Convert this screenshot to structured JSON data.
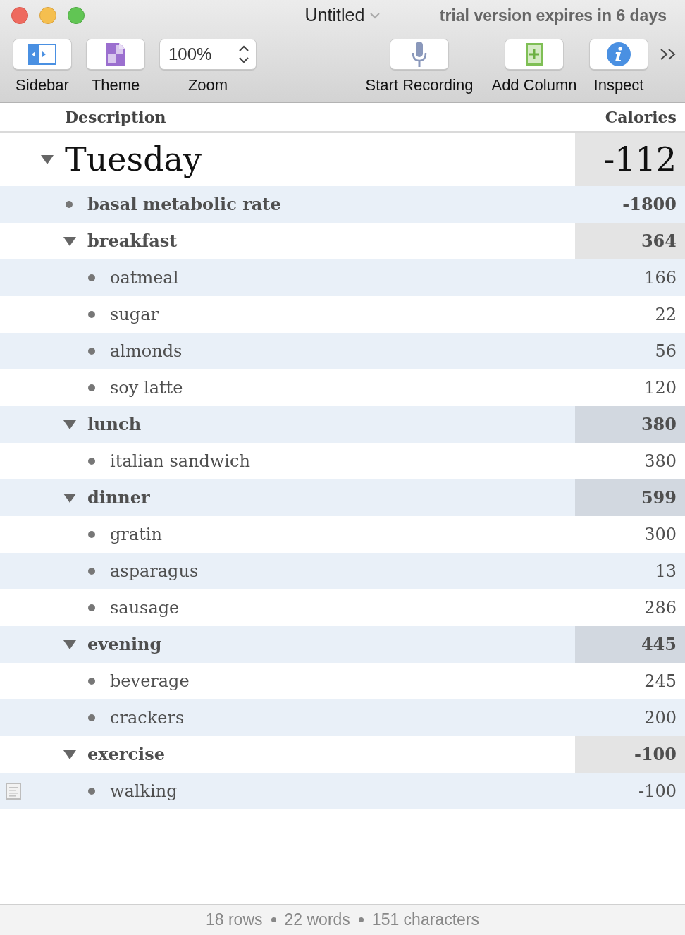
{
  "window": {
    "title": "Untitled",
    "notice": "trial version expires in 6 days"
  },
  "toolbar": {
    "left": [
      {
        "kind": "button",
        "label": "Sidebar"
      },
      {
        "kind": "button",
        "label": "Theme"
      },
      {
        "kind": "stepper",
        "label": "Zoom",
        "value": "100%"
      }
    ],
    "right": [
      {
        "kind": "button",
        "label": "Start Recording"
      },
      {
        "kind": "button",
        "label": "Add Column"
      },
      {
        "kind": "button",
        "label": "Inspect"
      }
    ]
  },
  "table": {
    "columns": [
      "Description",
      "Calories"
    ],
    "rows": [
      {
        "description": "Tuesday",
        "calories": "-112",
        "expanded": true,
        "note": false,
        "children": [
          {
            "description": "basal metabolic rate",
            "calories": "-1800",
            "note": false
          },
          {
            "description": "breakfast",
            "calories": "364",
            "expanded": true,
            "note": false,
            "children": [
              {
                "description": "oatmeal",
                "calories": "166",
                "note": false
              },
              {
                "description": "sugar",
                "calories": "22",
                "note": false
              },
              {
                "description": "almonds",
                "calories": "56",
                "note": false
              },
              {
                "description": "soy latte",
                "calories": "120",
                "note": false
              }
            ]
          },
          {
            "description": "lunch",
            "calories": "380",
            "expanded": true,
            "note": false,
            "children": [
              {
                "description": "italian sandwich",
                "calories": "380",
                "note": false
              }
            ]
          },
          {
            "description": "dinner",
            "calories": "599",
            "expanded": true,
            "note": false,
            "children": [
              {
                "description": "gratin",
                "calories": "300",
                "note": false
              },
              {
                "description": "asparagus",
                "calories": "13",
                "note": false
              },
              {
                "description": "sausage",
                "calories": "286",
                "note": false
              }
            ]
          },
          {
            "description": "evening",
            "calories": "445",
            "expanded": true,
            "note": false,
            "children": [
              {
                "description": "beverage",
                "calories": "245",
                "note": false
              },
              {
                "description": "crackers",
                "calories": "200",
                "note": false
              }
            ]
          },
          {
            "description": "exercise",
            "calories": "-100",
            "expanded": true,
            "note": false,
            "children": [
              {
                "description": "walking",
                "calories": "-100",
                "note": true
              }
            ]
          }
        ]
      }
    ]
  },
  "status_bar": [
    "18 rows",
    "22 words",
    "151 characters"
  ]
}
